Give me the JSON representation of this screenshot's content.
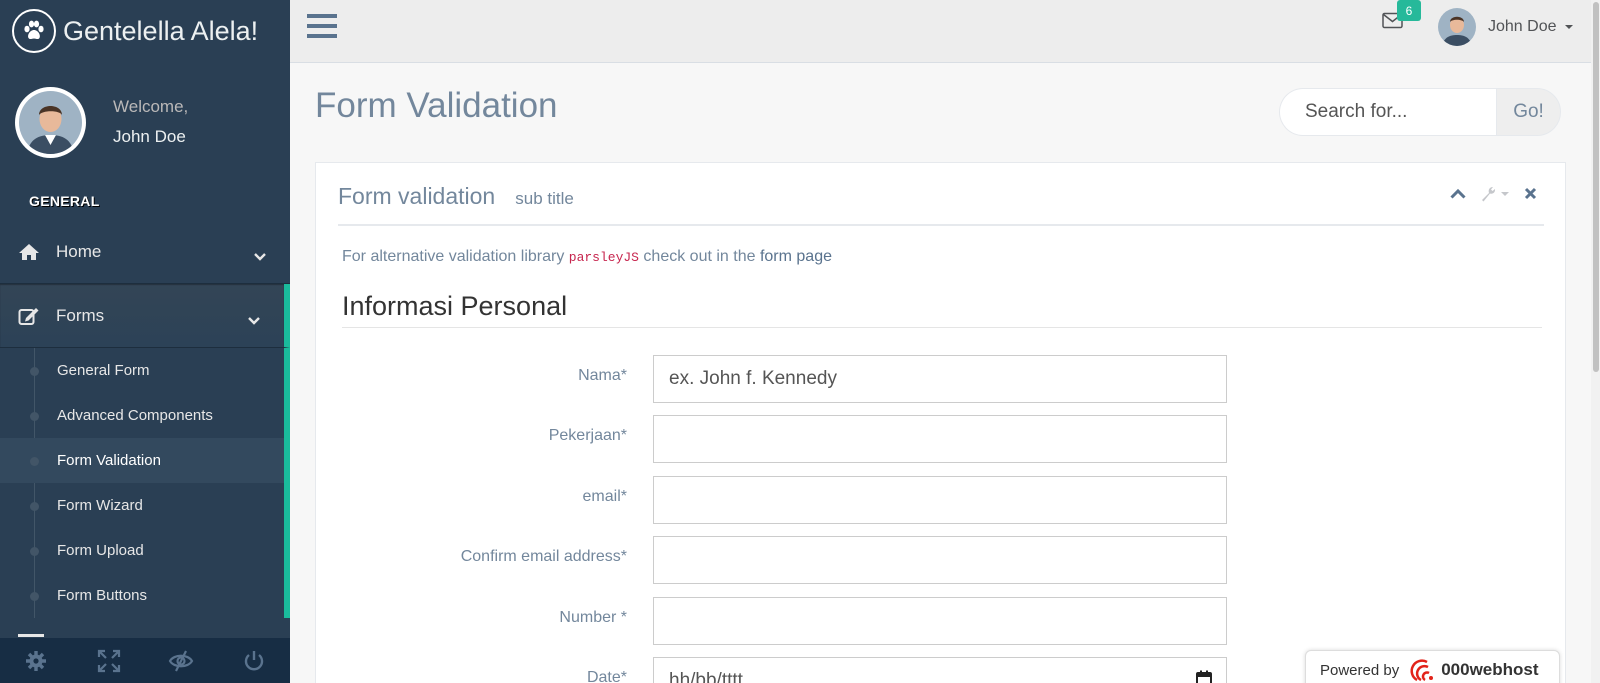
{
  "brand": {
    "title": "Gentelella Alela!",
    "logo_icon": "paw-icon"
  },
  "profile": {
    "welcome": "Welcome,",
    "name": "John Doe"
  },
  "sidebar": {
    "section": "GENERAL",
    "items": [
      {
        "label": "Home",
        "icon": "home-icon"
      },
      {
        "label": "Forms",
        "icon": "edit-icon"
      }
    ],
    "forms_children": [
      {
        "label": "General Form"
      },
      {
        "label": "Advanced Components"
      },
      {
        "label": "Form Validation"
      },
      {
        "label": "Form Wizard"
      },
      {
        "label": "Form Upload"
      },
      {
        "label": "Form Buttons"
      }
    ],
    "footer_icons": [
      "gear-icon",
      "fullscreen-icon",
      "eye-slash-icon",
      "power-icon"
    ]
  },
  "topnav": {
    "mail_count": "6",
    "user_name": "John Doe"
  },
  "page": {
    "title": "Form Validation"
  },
  "search": {
    "placeholder": "Search for...",
    "button": "Go!"
  },
  "panel": {
    "title": "Form validation",
    "subtitle": "sub title",
    "intro_prefix": "For alternative validation library ",
    "intro_code": "parsleyJS",
    "intro_middle": " check out in the ",
    "intro_link": "form page",
    "legend": "Informasi Personal"
  },
  "fields": [
    {
      "label": "Nama*",
      "placeholder": "ex. John f. Kennedy"
    },
    {
      "label": "Pekerjaan*",
      "placeholder": ""
    },
    {
      "label": "email*",
      "placeholder": ""
    },
    {
      "label": "Confirm email address*",
      "placeholder": ""
    },
    {
      "label": "Number *",
      "placeholder": ""
    },
    {
      "label": "Date*",
      "value": "hh/bb/tttt"
    }
  ],
  "powered": {
    "text": "Powered by",
    "brand": "000webhost"
  },
  "colors": {
    "sidebar": "#2A3F54",
    "accent": "#1ABB9C",
    "badge": "#26B99A",
    "text": "#73879C"
  }
}
